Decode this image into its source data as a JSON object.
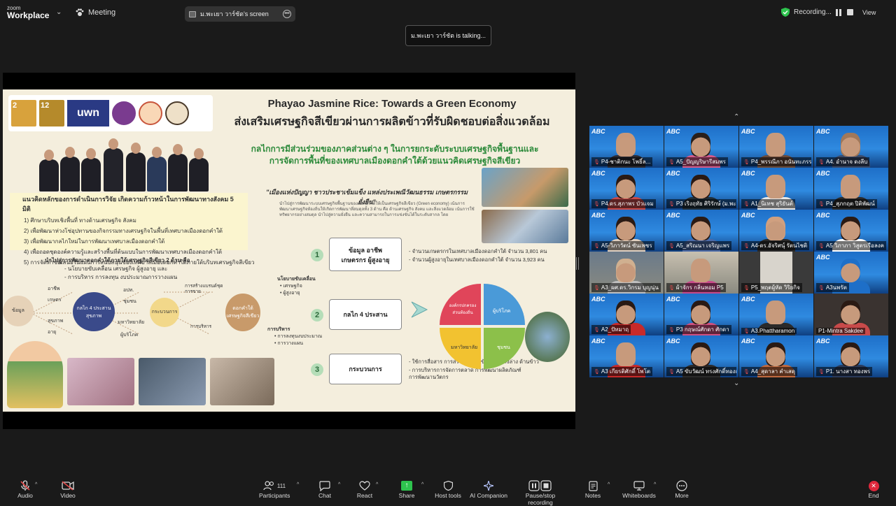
{
  "app": {
    "brand_small": "zoom",
    "brand_large": "Workplace",
    "meeting_label": "Meeting"
  },
  "screen_chip": {
    "label": "ม.พะเยา วาร์ชัต's screen"
  },
  "recording": {
    "label": "Recording..."
  },
  "view_label": "View",
  "talking": {
    "label": "ม.พะเยา วาร์ชัต is talking..."
  },
  "slide": {
    "title_en": "Phayao Jasmine Rice: Towards a Green Economy",
    "title_th": "ส่งเสริมเศรษฐกิจสีเขียวผ่านการผลิตข้าวที่รับผิดชอบต่อสิ่งแวดล้อม",
    "sub1": "กลไกการมีส่วนร่วมของภาคส่วนต่าง ๆ ในการยกระดับระบบเศรษฐกิจพื้นฐานและ",
    "sub2": "การจัดการพื้นที่ของเทศบาลเมืองดอกคำใต้ด้วยแนวคิดเศรษฐกิจสีเขียว",
    "logo_uwn": "uwn",
    "sdg2": "2",
    "sdg12": "12",
    "concept_head": "แนวคิดหลักของการดำเนินการวิจัย เกิดความก้าวหน้าในการพัฒนาทางสังคม 5 มิติ",
    "concept_items": [
      "1) ศึกษาบริบทเชิงพื้นที่ ทางด้านเศรษฐกิจ สังคม",
      "2) เพื่อพัฒนาห่วงโซ่อุปทานของกิจกรรมทางเศรษฐกิจในพื้นที่เทศบาลเมืองดอกคำใต้",
      "3) เพื่อพัฒนากลไกใหม่ในการพัฒนาเทศบาลเมืองดอกคำใต้",
      "4) เพื่อถอดชุดองค์ความรู้และสร้างพื้นที่ต้นแบบในการพัฒนาเทศบาลเมืองดอกคำใต้",
      "5) การจัดทำข้อเสนอในแผนการสนับสนุนของเทศบาลเมืองดอกคำใต้ภายใต้บริบทเศรษฐกิจสีเขียว"
    ],
    "slogan": "\"เมืองแห่งปัญญา ชาวประชาเข้มแข็ง แหล่งประเพณีวัฒนธรรม เกษตรกรรมยั่งยืน\"",
    "para": "นำไปสู่การพัฒนาระบบเศรษฐกิจพื้นฐานของดอกคำใต้ให้เป็นเศรษฐกิจสีเขียว (Green economy) เน้นการพัฒนาเศรษฐกิจท้องถิ่นให้เกิดการพัฒนาที่สมดุลทั้ง 3 ด้าน คือ ด้านเศรษฐกิจ สังคม และสิ่งแวดล้อม เน้นการใช้ทรัพยากรอย่างสมดุล นำไปสู่ความยั่งยืน และความสามารถในการแข่งขันได้ในระดับสากล โดย",
    "lead_text": "นำไปสู่การพัฒนาดอกคำใต้ภายใต้เศรษฐกิจสีเขียว 2 ด้าน คือ",
    "lead_items": [
      "- นโยบายขับเคลื่อน เศรษฐกิจ ผู้สูงอายุ และ",
      "- การบริหาร การลงทุน งบประมาณการวางแผน"
    ],
    "flow_nodes": {
      "data": "ข้อมูล",
      "mech": "กลไก 4 ประสาน สุขภาพ",
      "process": "กระบวนการ",
      "green": "ดอกคำใต้ เศรษฐกิจสีเขียว"
    },
    "flow_words": [
      "อาชีพ",
      "เกษตร",
      "สุขภาพ",
      "อายุ",
      "อปท.",
      "ชุมชน",
      "มหาวิทยาลัย",
      "ผู้บริโภค",
      "การสร้างแบรนด์ชุด",
      "การขาย",
      "การบริหาร"
    ],
    "right_words": {
      "policy": "นโยบายขับเคลื่อน",
      "policy_a": "• เศรษฐกิจ",
      "policy_b": "• ผู้สูงอายุ",
      "admin": "การบริหาร",
      "admin_a": "• การลงทุนงบประมาณ",
      "admin_b": "• การวางแผน"
    },
    "steps": [
      {
        "num": "1",
        "label": "ข้อมูล อาชีพ เกษตรกร ผู้สูงอายุ"
      },
      {
        "num": "2",
        "label": "กลไก 4 ประสาน"
      },
      {
        "num": "3",
        "label": "กระบวนการ"
      }
    ],
    "step_bullets": [
      "- จำนวนเกษตรกรในเทศบาลเมืองดอกคำใต้ จำนวน 3,801 คน",
      "- จำนวนผู้สูงอายุในเทศบาลเมืองดอกคำใต้ จำนวน 3,923 คน",
      "- ใช้การสื่อสาร การสร้างแบรนด์ข้าวโบนแสงล่าง ด้านข้าว",
      "- การบริหารการจัดการตลาด การพัฒนาผลิตภัณฑ์",
      "  การพัฒนานวัตกร"
    ],
    "pie": {
      "quadrants": [
        {
          "label": "องค์กรปกครองส่วนท้องถิ่น",
          "color": "#e0455a"
        },
        {
          "label": "ผู้บริโภค",
          "color": "#4a9ad8"
        },
        {
          "label": "ชุมชน",
          "color": "#8cc04a"
        },
        {
          "label": "มหาวิทยาลัย",
          "color": "#f2c230"
        }
      ]
    }
  },
  "participants": [
    {
      "name": "P4-ชาติกนะ โพธิ์ล...",
      "muted": true
    },
    {
      "name": "A5_ปัญญริษารีสมพร",
      "muted": true
    },
    {
      "name": "P4_พรรณีภา อนันทะภรร...",
      "muted": true
    },
    {
      "name": "A4. อำนาจ ดงลีบ",
      "muted": true
    },
    {
      "name": "P4.ดร.สุภาพร บัวแจม",
      "muted": true
    },
    {
      "name": "P3 เริงฤทัย ศิริรักษ์ (ม.พะ...",
      "muted": true
    },
    {
      "name": "A1_นิเทช สุริยันต์",
      "muted": true
    },
    {
      "name": "P4_สุภกฤต ปิติพัฒน์",
      "muted": true
    },
    {
      "name": "A5-วิภาวัตน์ ซันเพชร",
      "muted": true
    },
    {
      "name": "A5_สริณนา เจริญแพร",
      "muted": true
    },
    {
      "name": "A4-ดร.อัจริศนุ์ รัตนไชติ",
      "muted": true
    },
    {
      "name": "A5 วิภาภา วิสูตรเรือลงค",
      "muted": true
    },
    {
      "name": "A3_ผศ.ดร.วิกรม บุญนุ่น",
      "muted": true
    },
    {
      "name": "ผ้าจักร กลิ่นหอม P5",
      "muted": true
    },
    {
      "name": "P5_พฤตผู้หัด วิริยกิจ",
      "muted": true
    },
    {
      "name": "A3นพรัต",
      "muted": true
    },
    {
      "name": "A2_ปัทมาฤ",
      "muted": true
    },
    {
      "name": "P3 กฤษณ์ศักดา ศักดา",
      "muted": true
    },
    {
      "name": "A3.Phattharamon",
      "muted": true
    },
    {
      "name": "P1-Mintra Sakdee",
      "muted": false
    },
    {
      "name": "A3 เกียรติศักดิ์ โพโต",
      "muted": true
    },
    {
      "name": "A5 ขับวัฒน์ ทรงศักดิ์ทองเล็ก",
      "muted": true
    },
    {
      "name": "A4_สุดาลา คำเสดุ",
      "muted": true
    },
    {
      "name": "P1. นางสา ทองพร",
      "muted": true
    }
  ],
  "tile_brand": "ABC",
  "toolbar": {
    "audio": "Audio",
    "video": "Video",
    "participants": "Participants",
    "participants_count": "111",
    "chat": "Chat",
    "react": "React",
    "share": "Share",
    "host_tools": "Host tools",
    "ai": "AI Companion",
    "pause": "Pause/stop recording",
    "notes": "Notes",
    "whiteboards": "Whiteboards",
    "more": "More",
    "end": "End"
  }
}
